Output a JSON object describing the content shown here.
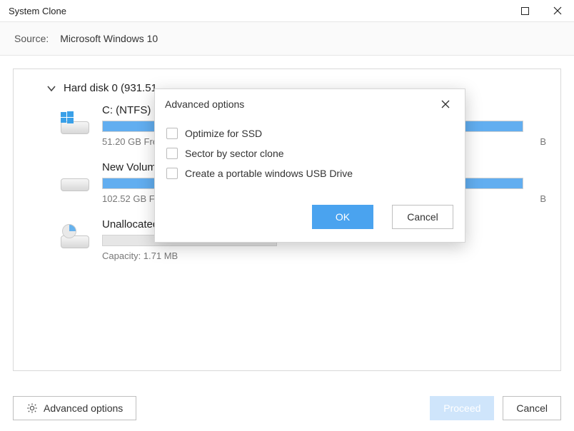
{
  "window": {
    "title": "System Clone"
  },
  "source": {
    "label": "Source:",
    "value": "Microsoft Windows 10"
  },
  "disk": {
    "header": "Hard disk 0 (931.51",
    "partitions": [
      {
        "title": "C: (NTFS)",
        "sub_left": "51.20 GB Free",
        "sub_right": "B",
        "fill_pct": 100,
        "icon": "windows"
      },
      {
        "title": "New Volum",
        "sub_left": "102.52 GB Fre",
        "sub_right": "B",
        "fill_pct": 100,
        "icon": "plain"
      },
      {
        "title": "Unallocated",
        "sub_left": "Capacity: 1.71 MB",
        "sub_right": "",
        "fill_pct": 0,
        "icon": "pie",
        "bar_small": true
      }
    ]
  },
  "footer": {
    "advanced": "Advanced options",
    "proceed": "Proceed",
    "cancel": "Cancel"
  },
  "modal": {
    "title": "Advanced options",
    "options": [
      "Optimize for SSD",
      "Sector by sector clone",
      "Create a portable windows USB Drive"
    ],
    "ok": "OK",
    "cancel": "Cancel"
  }
}
